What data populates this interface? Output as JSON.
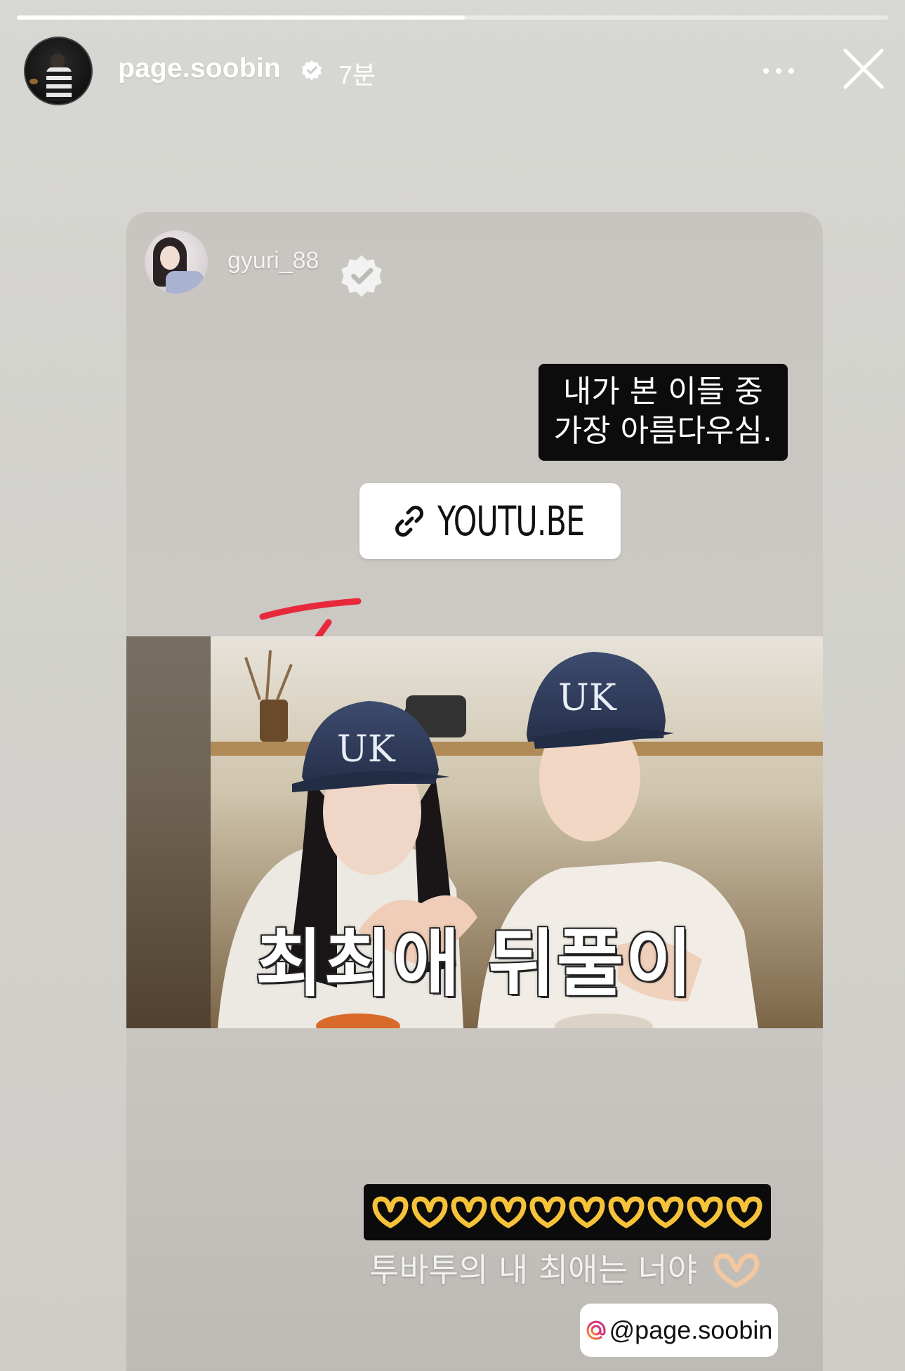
{
  "story": {
    "progress": 0.514,
    "username": "page.soobin",
    "time_ago": "7분",
    "verified": true
  },
  "reshared_post": {
    "username": "gyuri_88",
    "verified": true,
    "caption_lines": [
      "내가 본 이들 중",
      "가장 아름다우심."
    ],
    "link_sticker": "YOUTU.BE",
    "video_title": "최최애 뒤풀이",
    "emoji_count": 10,
    "sub_caption": "투바투의 내 최애는 너야",
    "mention": "@page.soobin"
  },
  "colors": {
    "arrow": "#e7293b",
    "sticker_bg": "#ffffff",
    "caption_bg": "#0c0c0c",
    "heart_hands": "#f5c23a"
  },
  "icons": [
    "link-icon",
    "verified-icon",
    "more-icon",
    "close-icon",
    "heart-hands-icon",
    "mention-icon"
  ]
}
